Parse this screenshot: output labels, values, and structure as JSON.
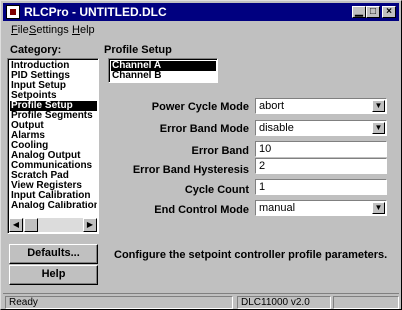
{
  "window": {
    "title": "RLCPro - UNTITLED.DLC",
    "minimize_glyph": "▁",
    "maximize_glyph": "□",
    "close_glyph": "×"
  },
  "menu": {
    "items": [
      {
        "key": "F",
        "rest": "ile"
      },
      {
        "key": "S",
        "rest": "ettings"
      },
      {
        "key": "H",
        "rest": "elp"
      }
    ]
  },
  "sidebar": {
    "heading": "Category:",
    "items": [
      {
        "label": "Introduction",
        "selected": false
      },
      {
        "label": "PID Settings",
        "selected": false
      },
      {
        "label": "Input Setup",
        "selected": false
      },
      {
        "label": "Setpoints",
        "selected": false
      },
      {
        "label": "Profile Setup",
        "selected": true
      },
      {
        "label": "Profile Segments",
        "selected": false
      },
      {
        "label": "Output",
        "selected": false
      },
      {
        "label": "Alarms",
        "selected": false
      },
      {
        "label": "Cooling",
        "selected": false
      },
      {
        "label": "Analog Output",
        "selected": false
      },
      {
        "label": "Communications",
        "selected": false
      },
      {
        "label": "Scratch Pad",
        "selected": false
      },
      {
        "label": "View Registers",
        "selected": false
      },
      {
        "label": "Input Calibration",
        "selected": false
      },
      {
        "label": "Analog Calibration",
        "selected": false
      }
    ],
    "defaults_button": "Defaults...",
    "help_button": "Help"
  },
  "main": {
    "heading": "Profile Setup",
    "channels": [
      {
        "label": "Channel A",
        "selected": true
      },
      {
        "label": "Channel B",
        "selected": false
      }
    ],
    "fields": [
      {
        "label": "Power Cycle Mode",
        "value": "abort",
        "type": "dropdown"
      },
      {
        "label": "Error Band Mode",
        "value": "disable",
        "type": "dropdown"
      },
      {
        "label": "Error Band",
        "value": "10",
        "type": "text"
      },
      {
        "label": "Error Band Hysteresis",
        "value": "2",
        "type": "text"
      },
      {
        "label": "Cycle Count",
        "value": "1",
        "type": "text"
      },
      {
        "label": "End Control Mode",
        "value": "manual",
        "type": "dropdown"
      }
    ],
    "description": "Configure the setpoint controller profile parameters."
  },
  "status": {
    "left": "Ready",
    "right": "DLC11000 v2.0"
  },
  "colors": {
    "titlebar": "#000080",
    "face": "#c0c0c0"
  }
}
